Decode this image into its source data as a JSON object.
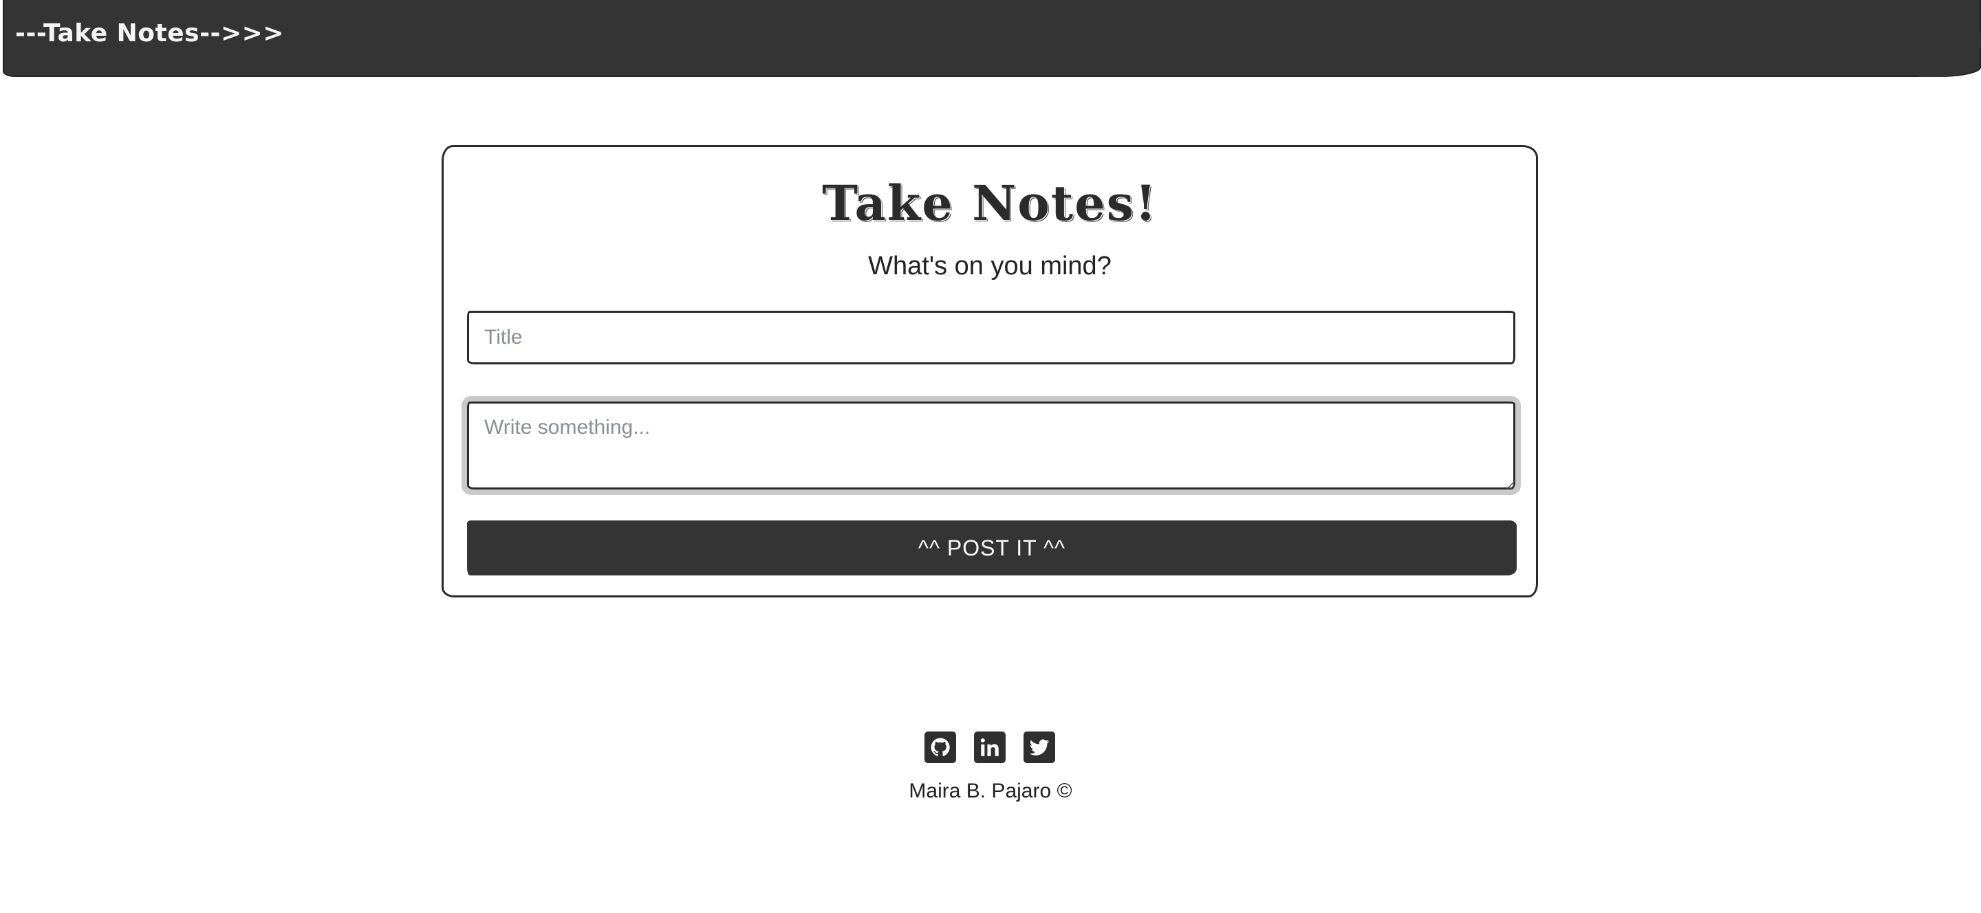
{
  "navbar": {
    "brand": "---Take Notes-->>>"
  },
  "card": {
    "title": "Take Notes!",
    "subtitle": "What's on you mind?",
    "title_input": {
      "placeholder": "Title",
      "value": ""
    },
    "content_input": {
      "placeholder": "Write something...",
      "value": ""
    },
    "post_button": "^^ POST IT ^^"
  },
  "footer": {
    "social_icons": [
      "github-icon",
      "linkedin-icon",
      "twitter-icon"
    ],
    "copyright": "Maira B. Pajaro ©"
  },
  "colors": {
    "dark": "#343434",
    "background": "#ffffff",
    "border": "#2a2a2a",
    "placeholder": "#8a8f95"
  }
}
